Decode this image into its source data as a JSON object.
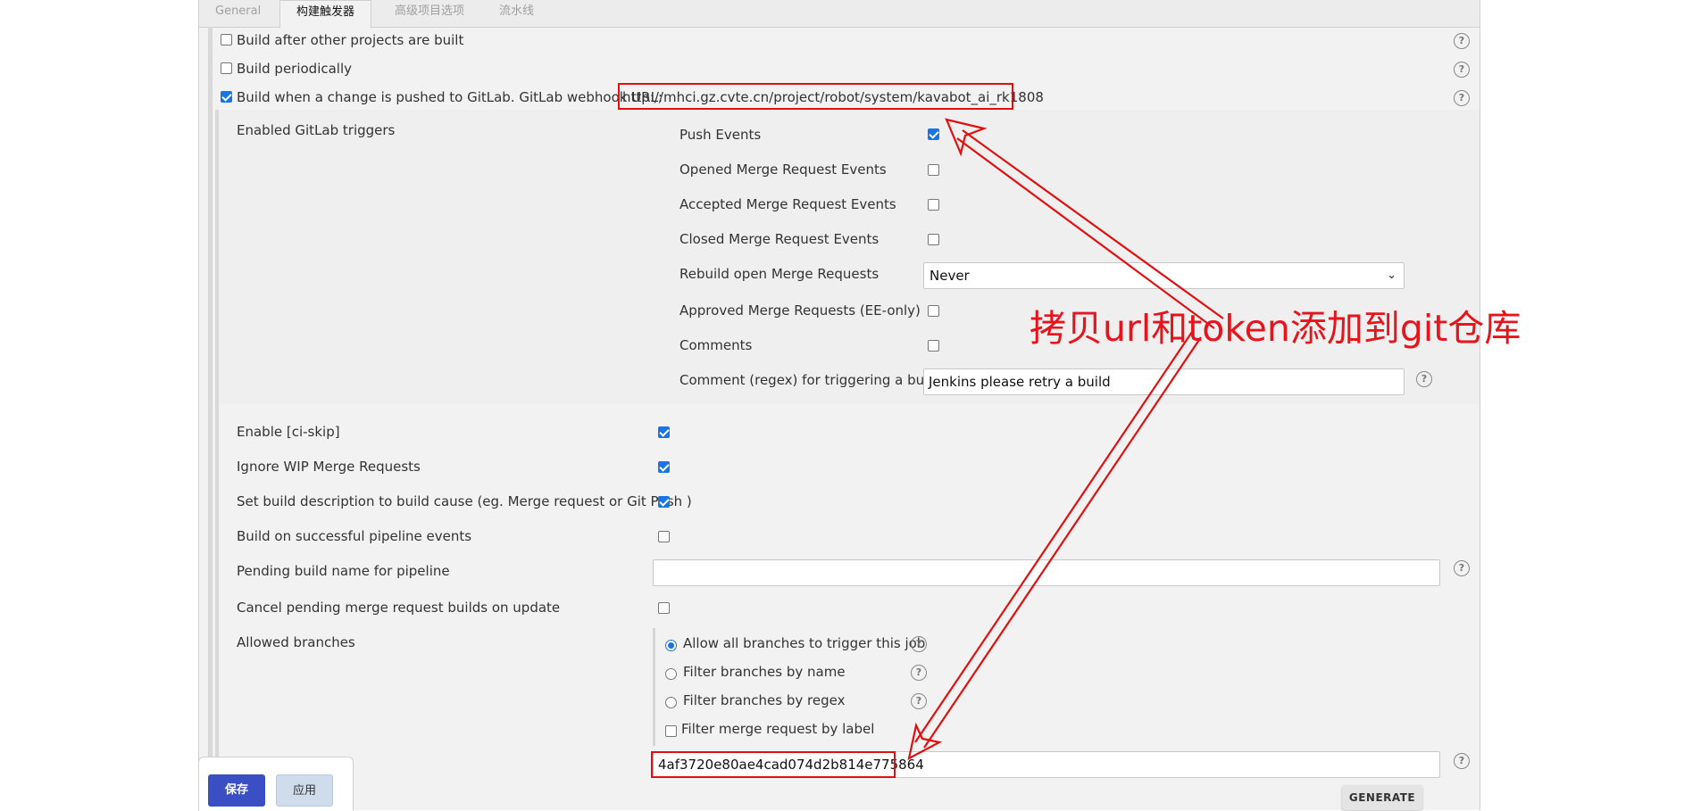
{
  "tabs": [
    "General",
    "构建触发器",
    "高级项目选项",
    "流水线"
  ],
  "triggers": {
    "build_after_other": "Build after other projects are built",
    "build_periodically": "Build periodically",
    "build_on_gitlab_push": "Build when a change is pushed to GitLab. GitLab webhook URL:",
    "webhook_url": "http://mhci.gz.cvte.cn/project/robot/system/kavabot_ai_rk1808"
  },
  "gitlab": {
    "enabled_triggers_label": "Enabled GitLab triggers",
    "events": [
      {
        "label": "Push Events",
        "checked": true
      },
      {
        "label": "Opened Merge Request Events",
        "checked": false
      },
      {
        "label": "Accepted Merge Request Events",
        "checked": false
      },
      {
        "label": "Closed Merge Request Events",
        "checked": false
      }
    ],
    "rebuild_label": "Rebuild open Merge Requests",
    "rebuild_value": "Never",
    "approved_label": "Approved Merge Requests (EE-only)",
    "comments_label": "Comments",
    "comment_regex_label": "Comment (regex) for triggering a build",
    "comment_regex_value": "Jenkins please retry a build"
  },
  "options": {
    "ci_skip": "Enable [ci-skip]",
    "ignore_wip": "Ignore WIP Merge Requests",
    "set_build_desc": "Set build description to build cause (eg. Merge request or Git Push )",
    "pipeline_events": "Build on successful pipeline events",
    "pending_build_name": "Pending build name for pipeline",
    "cancel_pending": "Cancel pending merge request builds on update",
    "allowed_branches": "Allowed branches"
  },
  "branches": {
    "allow_all": "Allow all branches to trigger this job",
    "by_name": "Filter branches by name",
    "by_regex": "Filter branches by regex",
    "by_label": "Filter merge request by label"
  },
  "secret_token": "4af3720e80ae4cad074d2b814e775864",
  "annotation_text": "拷贝url和token添加到git仓库",
  "buttons": {
    "save": "保存",
    "apply": "应用",
    "generate": "GENERATE"
  },
  "help_glyph": "?",
  "select_arrow": "⌄",
  "colors": {
    "accent": "#1a73e8",
    "annotation": "#e8131b",
    "save_button": "#3b4fc4"
  }
}
